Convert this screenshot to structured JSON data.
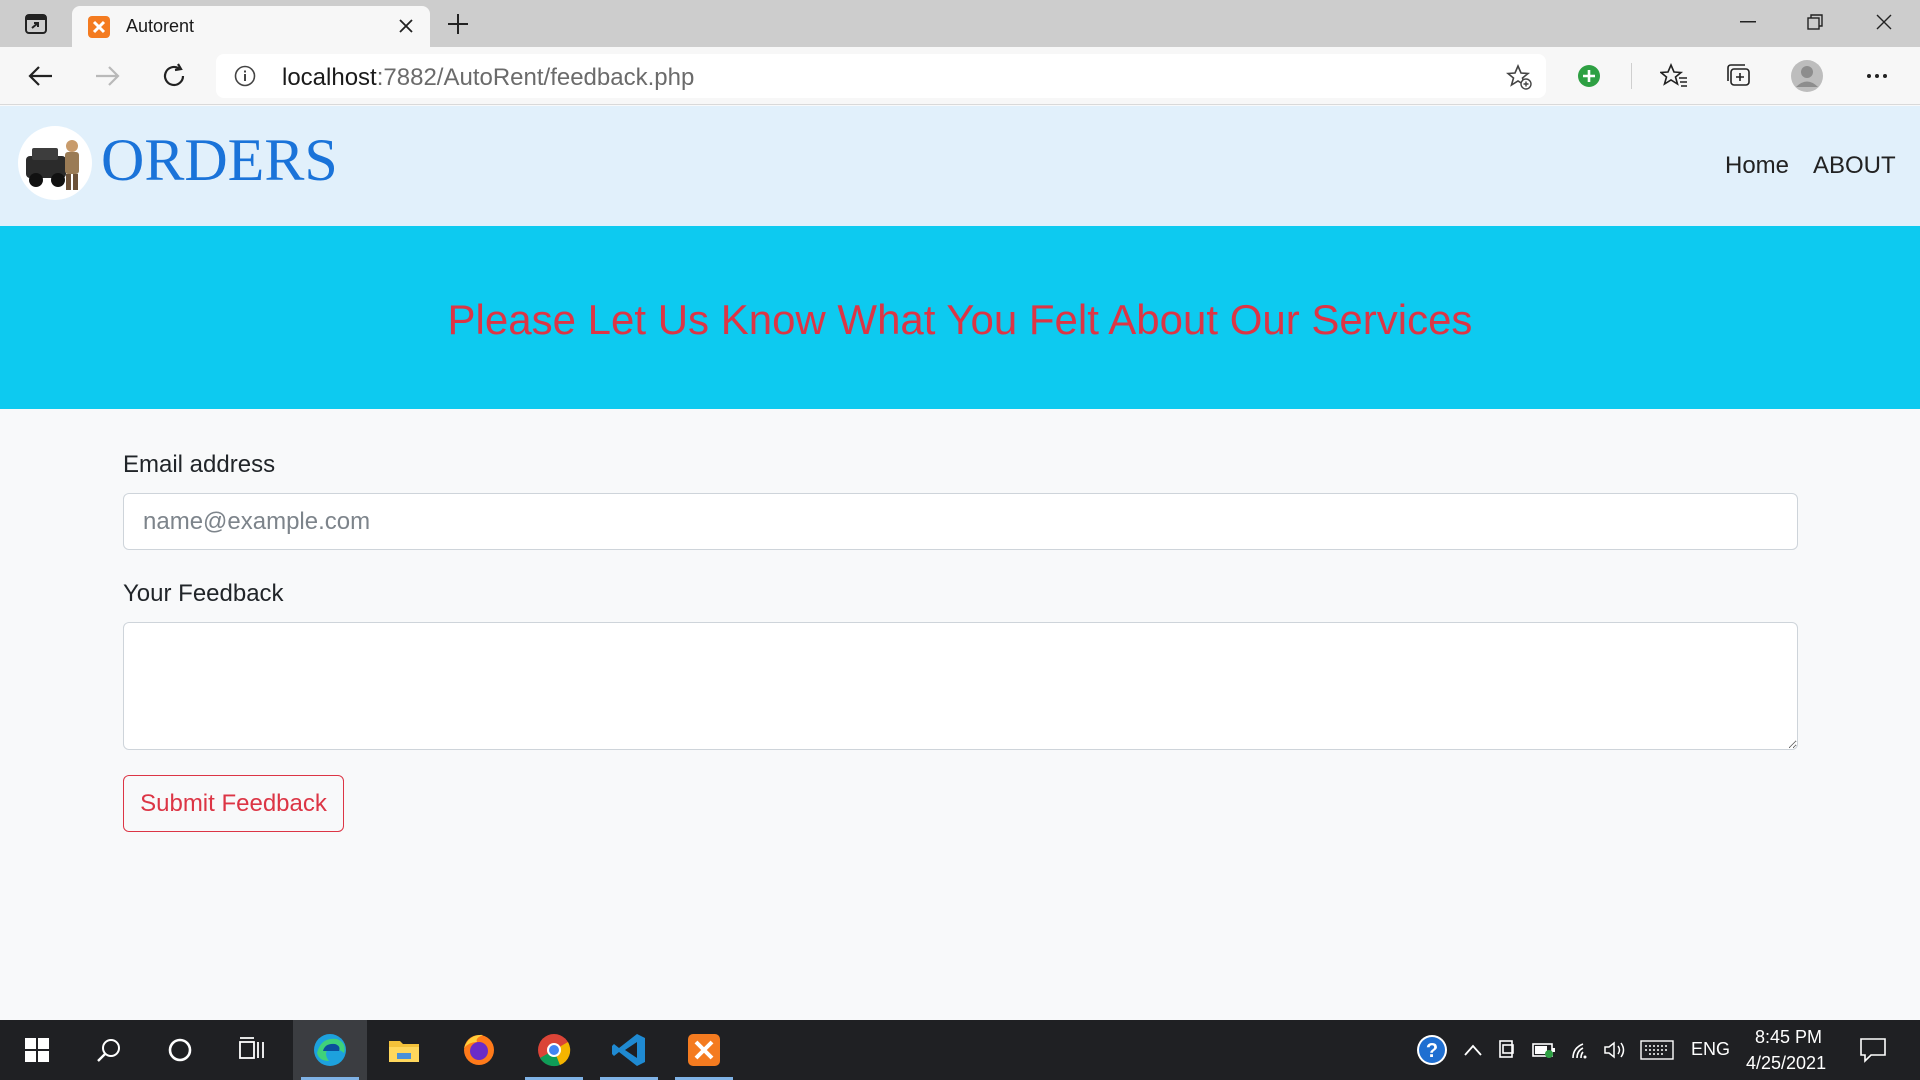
{
  "browser": {
    "tab": {
      "title": "Autorent",
      "favicon": "xampp-icon"
    },
    "address": {
      "host": "localhost",
      "rest": ":7882/AutoRent/feedback.php"
    }
  },
  "page": {
    "brand": "ORDERS",
    "nav": {
      "home": "Home",
      "about": "ABOUT"
    },
    "hero_title": "Please Let Us Know What You Felt About Our Services",
    "form": {
      "email_label": "Email address",
      "email_placeholder": "name@example.com",
      "email_value": "",
      "feedback_label": "Your Feedback",
      "feedback_value": "",
      "submit_label": "Submit Feedback"
    }
  },
  "taskbar": {
    "language": "ENG",
    "time": "8:45 PM",
    "date": "4/25/2021"
  },
  "colors": {
    "navbar_bg": "#e1f0fb",
    "brand": "#1a73d9",
    "hero_bg": "#0dcaf0",
    "accent_red": "#dc3545"
  }
}
